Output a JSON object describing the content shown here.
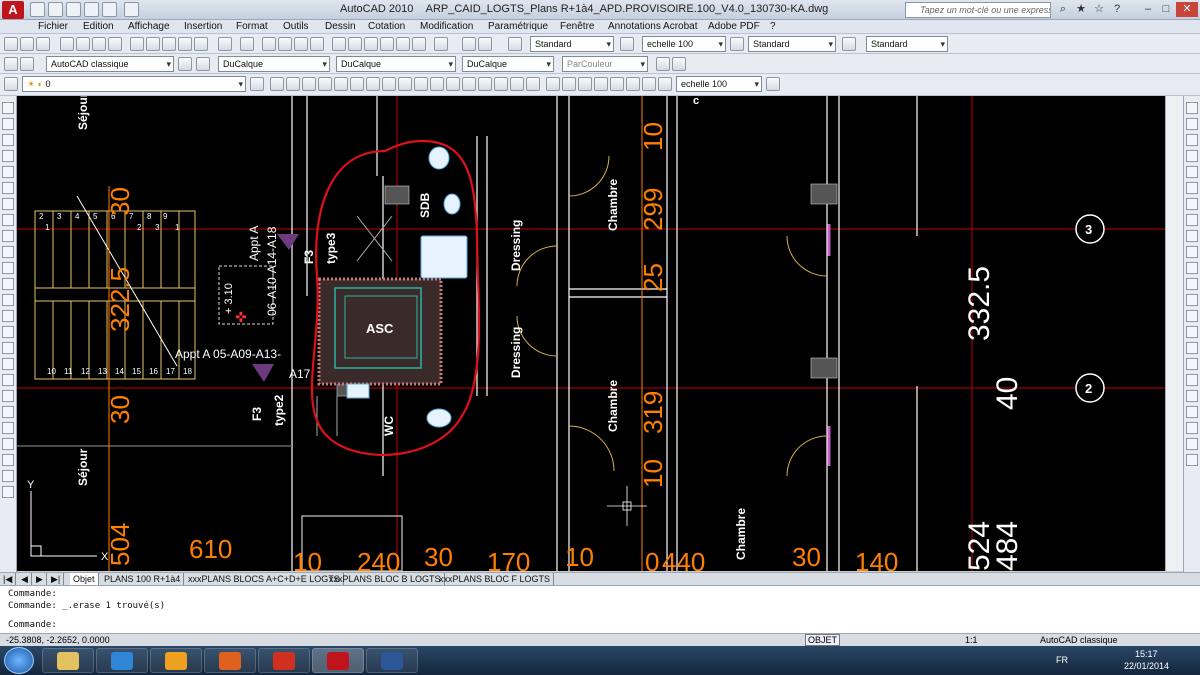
{
  "window": {
    "app_title": "AutoCAD 2010",
    "file_name": "ARP_CAID_LOGTS_Plans R+1à4_APD.PROVISOIRE.100_V4.0_130730-KA.dwg",
    "search_placeholder": "Tapez un mot-clé ou une expression"
  },
  "menu": [
    "Fichier",
    "Edition",
    "Affichage",
    "Insertion",
    "Format",
    "Outils",
    "Dessin",
    "Cotation",
    "Modification",
    "Paramétrique",
    "Fenêtre",
    "Annotations Acrobat",
    "Adobe PDF",
    "?"
  ],
  "toolbar1": {
    "text_style": "Standard",
    "dim_scale": "echelle 100",
    "dim_style": "Standard",
    "table_style": "Standard"
  },
  "toolbar2": {
    "workspace": "AutoCAD classique",
    "layer_color": "DuCalque",
    "linetype": "DuCalque",
    "lineweight": "DuCalque",
    "plot_style": "ParCouleur"
  },
  "toolbar3": {
    "layer": "0",
    "annotation_scale": "echelle 100"
  },
  "drawing": {
    "room_labels": [
      "Séjour",
      "Séjour",
      "SDB",
      "Dressing",
      "Dressing",
      "Chambre",
      "Chambre",
      "Chambre",
      "ASC",
      "WC"
    ],
    "appt_labels": [
      "Appt A",
      "06-A10-A14-A18",
      "F3",
      "type3",
      "Appt A 05-A09-A13-",
      "A17",
      "F3",
      "type2"
    ],
    "level": "+ 3.10",
    "stair_numbers_top": [
      "2",
      "3",
      "4",
      "5",
      "6",
      "7",
      "8",
      "9",
      "1",
      "2",
      "3",
      "1"
    ],
    "stair_numbers_bottom": [
      "10",
      "11",
      "12",
      "13",
      "14",
      "15",
      "16",
      "17",
      "18"
    ],
    "dimensions": [
      "30",
      "322.5",
      "30",
      "504",
      "610",
      "10",
      "240",
      "30",
      "170",
      "10",
      "0",
      "440",
      "30",
      "140",
      "10",
      "299",
      "25",
      "319",
      "10",
      "332.5",
      "40",
      "524",
      "484"
    ],
    "grid_markers": [
      "3",
      "2"
    ],
    "axis_y": "Y",
    "axis_x": "X",
    "top_clip": "c"
  },
  "layout_tabs": [
    "Objet",
    "PLANS 100 R+1à4",
    "xxxPLANS BLOCS A+C+D+E LOGTS",
    "xxxPLANS BLOC B LOGTS",
    "xxxPLANS BLOC F LOGTS"
  ],
  "command": {
    "line1": "Commande:",
    "line2": "Commande:  _.erase 1 trouvé(s)",
    "prompt": "Commande:"
  },
  "status": {
    "coords": "-25.3808, -2.2652, 0.0000",
    "objet": "OBJET",
    "scale": "1:1",
    "workspace": "AutoCAD classique"
  },
  "taskbar": {
    "lang": "FR",
    "time": "15:17",
    "date": "22/01/2014"
  },
  "colors": {
    "dimension_orange": "#ff7f00",
    "markup_red": "#e0101a",
    "wall_white": "#ffffff",
    "grid_red": "#c00000"
  }
}
